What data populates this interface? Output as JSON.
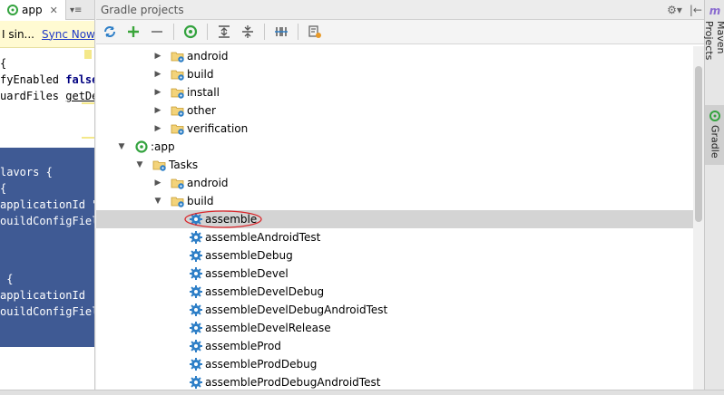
{
  "editor": {
    "tab_label": "app",
    "tab_close": "✕",
    "tab_menu": "▾≡",
    "banner_text": "I sin...",
    "banner_link": "Sync Now",
    "lines": [
      {
        "text": "{"
      },
      {
        "pre": "fyEnabled ",
        "kw": "false"
      },
      {
        "pre": "uardFiles ",
        "ul": "getDe"
      },
      {
        "text": "lavors {"
      },
      {
        "text": "{"
      },
      {
        "text": "applicationId \""
      },
      {
        "text": "ouildConfigFiel"
      },
      {
        "text": " {"
      },
      {
        "text": "applicationId"
      },
      {
        "text": "ouildConfigFiel"
      }
    ]
  },
  "gradle_panel": {
    "title": "Gradle projects",
    "header_tools": [
      "⚙▾",
      "|←"
    ],
    "toolbar_icons": [
      "refresh-icon",
      "add-icon",
      "remove-icon",
      "execute-task-icon",
      "expand-all-icon",
      "collapse-all-icon",
      "toggle-offline-icon",
      "settings-icon"
    ],
    "tree": [
      {
        "label": "android",
        "type": "folder",
        "depth": 3,
        "expanded": false
      },
      {
        "label": "build",
        "type": "folder",
        "depth": 3,
        "expanded": false
      },
      {
        "label": "install",
        "type": "folder",
        "depth": 3,
        "expanded": false
      },
      {
        "label": "other",
        "type": "folder",
        "depth": 3,
        "expanded": false
      },
      {
        "label": "verification",
        "type": "folder",
        "depth": 3,
        "expanded": false
      },
      {
        "label": ":app",
        "type": "module",
        "depth": 1,
        "expanded": true
      },
      {
        "label": "Tasks",
        "type": "folder",
        "depth": 2,
        "expanded": true
      },
      {
        "label": "android",
        "type": "folder",
        "depth": 3,
        "expanded": false
      },
      {
        "label": "build",
        "type": "folder",
        "depth": 3,
        "expanded": true
      },
      {
        "label": "assemble",
        "type": "task",
        "depth": 4,
        "selected": true,
        "circled": true
      },
      {
        "label": "assembleAndroidTest",
        "type": "task",
        "depth": 4
      },
      {
        "label": "assembleDebug",
        "type": "task",
        "depth": 4
      },
      {
        "label": "assembleDevel",
        "type": "task",
        "depth": 4
      },
      {
        "label": "assembleDevelDebug",
        "type": "task",
        "depth": 4
      },
      {
        "label": "assembleDevelDebugAndroidTest",
        "type": "task",
        "depth": 4
      },
      {
        "label": "assembleDevelRelease",
        "type": "task",
        "depth": 4
      },
      {
        "label": "assembleProd",
        "type": "task",
        "depth": 4
      },
      {
        "label": "assembleProdDebug",
        "type": "task",
        "depth": 4
      },
      {
        "label": "assembleProdDebugAndroidTest",
        "type": "task",
        "depth": 4
      }
    ]
  },
  "right_strip": {
    "tabs": [
      {
        "label": "Maven Projects",
        "icon": "maven-icon",
        "active": false
      },
      {
        "label": "Gradle",
        "icon": "gradle-icon",
        "active": true
      }
    ]
  },
  "colors": {
    "selection_blue": "#3f5a94",
    "link": "#1d38c8",
    "gear_blue": "#2e7fc7",
    "gradle_green": "#34a33f",
    "circle_red": "#d9262b"
  }
}
